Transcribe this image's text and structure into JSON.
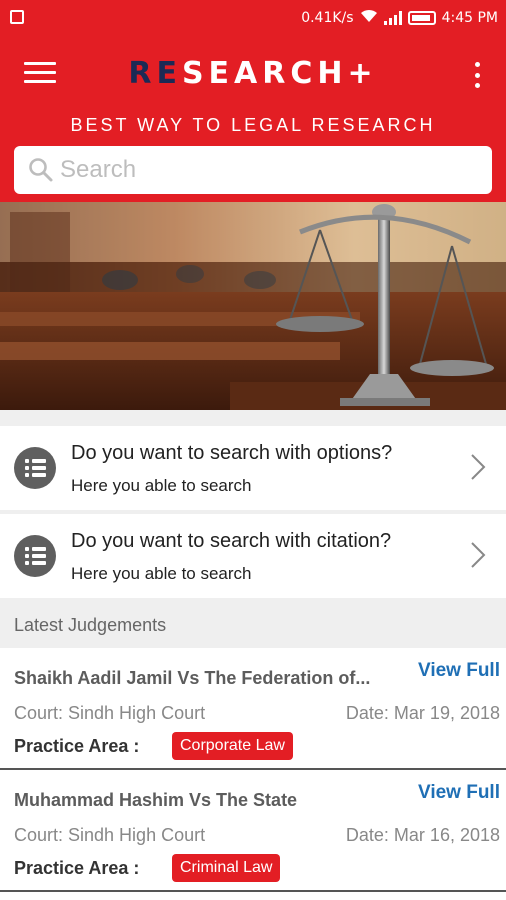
{
  "status_bar": {
    "speed": "0.41K/s",
    "time": "4:45 PM"
  },
  "app": {
    "logo_part1": "RE",
    "logo_part2": "SEARCH+",
    "tagline": "BEST WAY TO LEGAL RESEARCH",
    "brand_color": "#e31e24",
    "logo_dark_color": "#1c2a55"
  },
  "search": {
    "placeholder": "Search"
  },
  "banner": {
    "slide_count": 5,
    "active_slide": 3
  },
  "options": [
    {
      "title": "Do you want to search with options?",
      "subtitle": "Here you able to search"
    },
    {
      "title": "Do you want to search with citation?",
      "subtitle": "Here you able to search"
    }
  ],
  "latest": {
    "heading": "Latest Judgements",
    "view_label": "View Full",
    "practice_label": "Practice Area :",
    "items": [
      {
        "title": "Shaikh Aadil Jamil Vs The Federation of...",
        "court": "Court: Sindh High Court",
        "date": "Date: Mar 19, 2018",
        "area": "Corporate Law"
      },
      {
        "title": "Muhammad Hashim Vs The State",
        "court": "Court: Sindh High Court",
        "date": "Date: Mar 16, 2018",
        "area": "Criminal Law"
      }
    ]
  }
}
